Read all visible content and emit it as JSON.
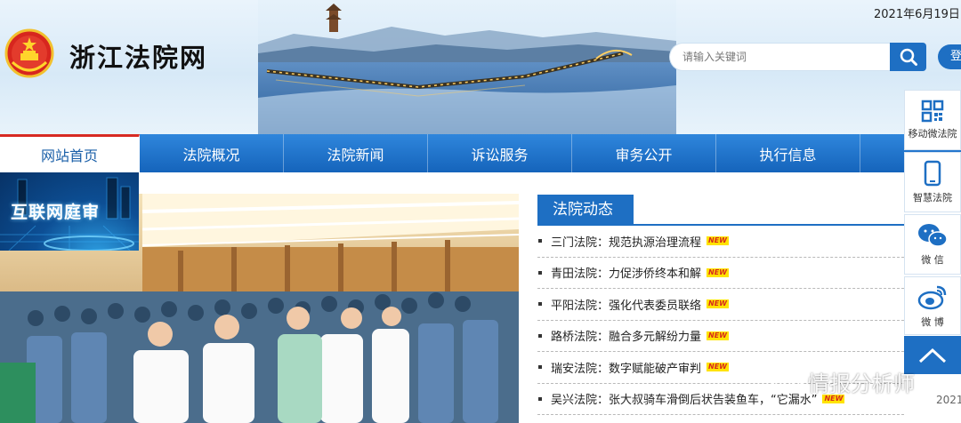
{
  "header": {
    "site_title": "浙江法院网",
    "date": "2021年6月19日",
    "login_label": "登录"
  },
  "search": {
    "placeholder": "请输入关键词"
  },
  "nav": {
    "items": [
      {
        "label": "网站首页"
      },
      {
        "label": "法院概况"
      },
      {
        "label": "法院新闻"
      },
      {
        "label": "诉讼服务"
      },
      {
        "label": "审务公开"
      },
      {
        "label": "执行信息"
      }
    ]
  },
  "feature": {
    "internet_court_title": "互联网庭审"
  },
  "news": {
    "title": "法院动态",
    "new_badge": "NEW",
    "items": [
      {
        "text": "三门法院：规范执源治理流程"
      },
      {
        "text": "青田法院：力促涉侨终本和解"
      },
      {
        "text": "平阳法院：强化代表委员联络"
      },
      {
        "text": "路桥法院：融合多元解纷力量"
      },
      {
        "text": "瑞安法院：数字赋能破产审判"
      },
      {
        "text": "吴兴法院：张大叔骑车滑倒后状告装鱼车，“它漏水”"
      }
    ]
  },
  "sidebar": {
    "items": [
      {
        "label": "移动微法院",
        "icon": "qr-code-icon"
      },
      {
        "label": "智慧法院",
        "icon": "mobile-phone-icon"
      },
      {
        "label": "微 信",
        "icon": "wechat-icon"
      },
      {
        "label": "微 博",
        "icon": "weibo-icon"
      }
    ]
  },
  "watermark": {
    "text": "情报分析师"
  },
  "footer_fragment": {
    "year": "2021"
  },
  "colors": {
    "primary_blue": "#1e6fc3",
    "active_tab_top": "#d72a23",
    "new_badge_bg": "#ffe300",
    "new_badge_text": "#d62b1e"
  }
}
